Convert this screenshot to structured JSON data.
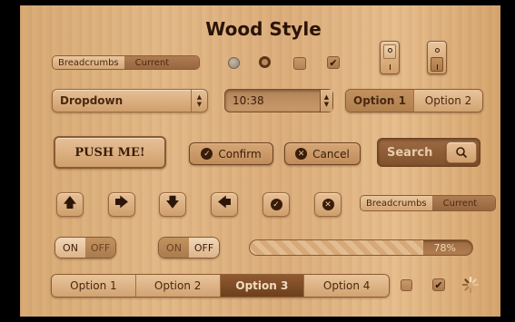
{
  "title": "Wood Style",
  "breadcrumbs_top": {
    "item1": "Breadcrumbs",
    "item2": "Current"
  },
  "breadcrumbs_bottom": {
    "item1": "Breadcrumbs",
    "item2": "Current"
  },
  "dropdown": {
    "value": "Dropdown"
  },
  "time_stepper": {
    "value": "10:38"
  },
  "option_toggle": {
    "option1": "Option 1",
    "option2": "Option 2"
  },
  "push_button": {
    "label": "PUSH ME!"
  },
  "confirm_button": {
    "label": "Confirm"
  },
  "cancel_button": {
    "label": "Cancel"
  },
  "search": {
    "placeholder": "Search"
  },
  "toggle1": {
    "on": "ON",
    "off": "OFF"
  },
  "toggle2": {
    "on": "ON",
    "off": "OFF"
  },
  "progress": {
    "value": 0.78,
    "label": "78%"
  },
  "segmented": {
    "options": [
      "Option 1",
      "Option 2",
      "Option 3",
      "Option 4"
    ],
    "selected_index": 2
  },
  "icons": {
    "up": "arrow-up-icon",
    "right": "arrow-right-icon",
    "down": "arrow-down-icon",
    "left": "arrow-left-icon",
    "check": "check-icon",
    "close": "close-icon"
  },
  "colors": {
    "wood_light": "#e2b886",
    "wood_dark": "#6e3f1c",
    "text_dark": "#2a1408"
  }
}
